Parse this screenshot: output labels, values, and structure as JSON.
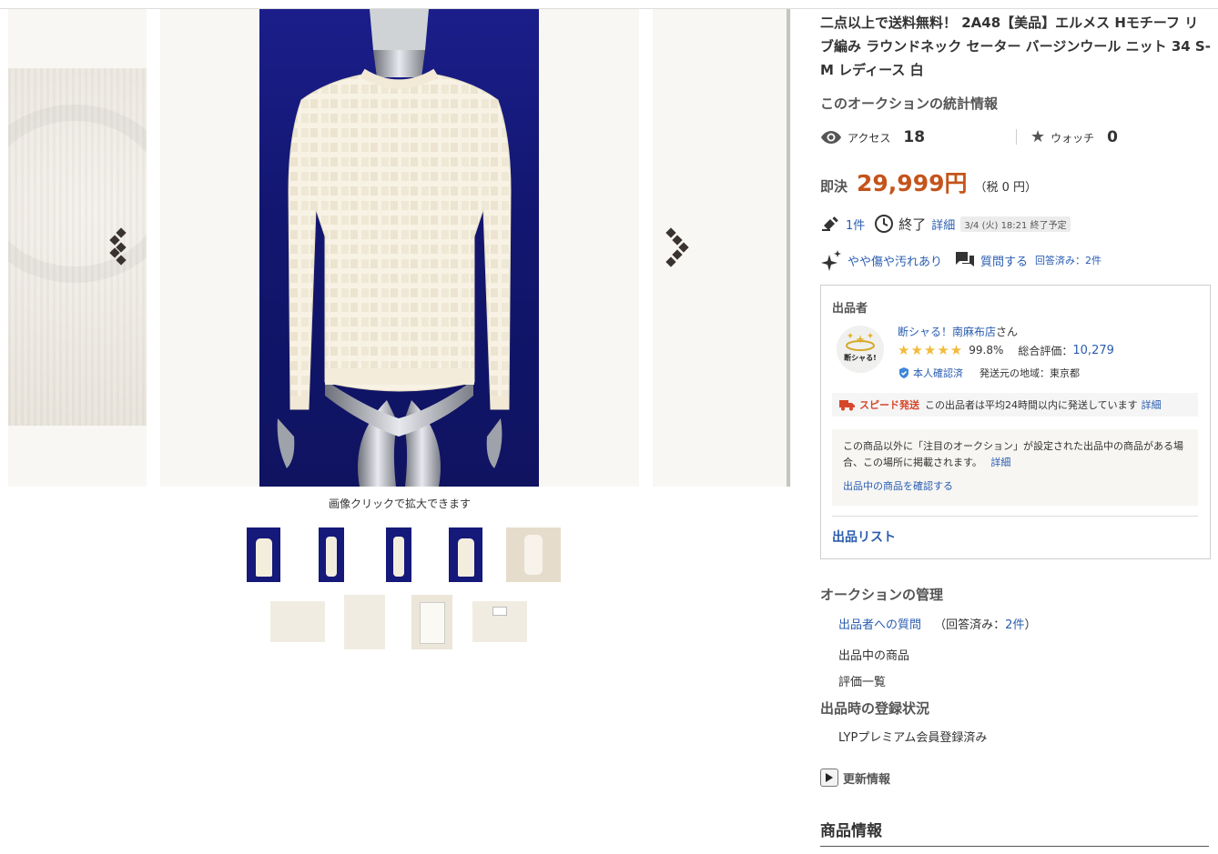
{
  "gallery": {
    "zoom_hint": "画像クリックで拡大できます",
    "prev_icon": "chevron-left-icon",
    "next_icon": "chevron-right-icon"
  },
  "item": {
    "title": "二点以上で送料無料！ 2A48【美品】エルメス Hモチーフ リブ編み ラウンドネック セーター バージンウール ニット 34 S-M レディース 白"
  },
  "stats": {
    "heading": "このオークションの統計情報",
    "access_label": "アクセス",
    "access_value": "18",
    "watch_label": "ウォッチ",
    "watch_value": "0"
  },
  "price": {
    "label": "即決",
    "value": "29,999円",
    "tax": "（税 0 円）",
    "price_color": "#c4541b"
  },
  "bids": {
    "count": "1件",
    "status": "終了",
    "detail_link": "詳細",
    "end_time": "3/4 (火) 18:21 終了予定"
  },
  "condition": {
    "label": "やや傷や汚れあり",
    "question_link": "質問する",
    "answered": "回答済み：2件"
  },
  "seller": {
    "heading": "出品者",
    "name": "断シャる！南麻布店",
    "name_suffix": "さん",
    "avatar_text": "断シャる!",
    "positive_rate": "99.8%",
    "rating_label": "総合評価：",
    "rating_value": "10,279",
    "verified": "本人確認済",
    "origin": "発送元の地域：東京都",
    "speed_label": "スピード発送",
    "speed_text": "この出品者は平均24時間以内に発送しています",
    "speed_link": "詳細",
    "notice_text": "この商品以外に「注目のオークション」が設定された出品中の商品がある場合、この場所に掲載されます。",
    "notice_link": "詳細",
    "notice_check_link": "出品中の商品を確認する",
    "list_link": "出品リスト"
  },
  "management": {
    "heading": "オークションの管理",
    "question_link": "出品者への質問",
    "answered_prefix": "（回答済み：",
    "answered_count": "2件",
    "answered_suffix": "）",
    "listing_link": "出品中の商品",
    "rating_link": "評価一覧"
  },
  "registration": {
    "heading": "出品時の登録状況",
    "value": "LYPプレミアム会員登録済み"
  },
  "update": {
    "label": "更新情報"
  },
  "product_info": {
    "heading": "商品情報"
  }
}
